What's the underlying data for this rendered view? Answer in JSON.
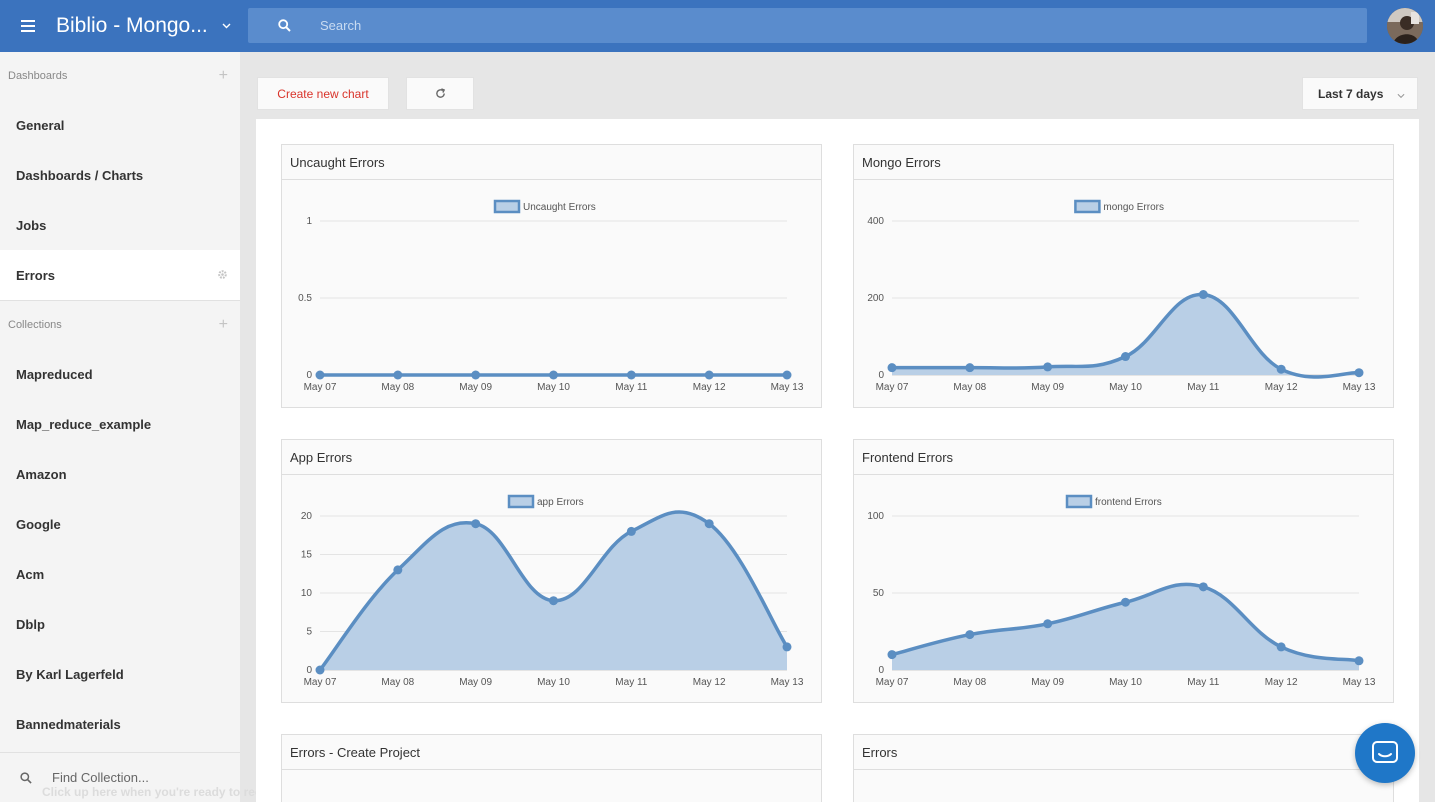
{
  "header": {
    "title": "Biblio - Mongo...",
    "search_placeholder": "Search",
    "menu_icon": "hamburger-icon",
    "avatar_icon": "user-avatar"
  },
  "sidebar": {
    "dashboards_heading": "Dashboards",
    "dashboards": [
      {
        "label": "General"
      },
      {
        "label": "Dashboards / Charts"
      },
      {
        "label": "Jobs"
      },
      {
        "label": "Errors",
        "active": true
      }
    ],
    "collections_heading": "Collections",
    "collections": [
      {
        "label": "Mapreduced"
      },
      {
        "label": "Map_reduce_example"
      },
      {
        "label": "Amazon"
      },
      {
        "label": "Google"
      },
      {
        "label": "Acm"
      },
      {
        "label": "Dblp"
      },
      {
        "label": "By Karl Lagerfeld"
      },
      {
        "label": "Bannedmaterials"
      }
    ],
    "find_placeholder": "Find Collection...",
    "record_hint": "Click up here when you're ready to record!"
  },
  "toolbar": {
    "create_label": "Create new chart",
    "refresh_icon": "refresh-icon",
    "range_label": "Last 7 days"
  },
  "colors": {
    "topbar": "#3b73be",
    "line": "#5b8ec2",
    "fill": "#b9cfe6",
    "accent_red": "#d9342b"
  },
  "chart_data": [
    {
      "type": "line",
      "title": "Uncaught Errors",
      "legend": "Uncaught Errors",
      "categories": [
        "May 07",
        "May 08",
        "May 09",
        "May 10",
        "May 11",
        "May 12",
        "May 13"
      ],
      "values": [
        0,
        0,
        0,
        0,
        0,
        0,
        0
      ],
      "ylim": [
        0,
        1
      ],
      "yticks": [
        "0",
        "0.5",
        "1"
      ],
      "area": false
    },
    {
      "type": "area",
      "title": "Mongo Errors",
      "legend": "mongo Errors",
      "categories": [
        "May 07",
        "May 08",
        "May 09",
        "May 10",
        "May 11",
        "May 12",
        "May 13"
      ],
      "values": [
        19,
        19,
        21,
        48,
        209,
        15,
        6
      ],
      "ylim": [
        0,
        400
      ],
      "yticks": [
        "0",
        "200",
        "400"
      ],
      "area": true
    },
    {
      "type": "area",
      "title": "App Errors",
      "legend": "app Errors",
      "categories": [
        "May 07",
        "May 08",
        "May 09",
        "May 10",
        "May 11",
        "May 12",
        "May 13"
      ],
      "values": [
        0,
        13,
        19,
        9,
        18,
        19,
        3
      ],
      "ylim": [
        0,
        20
      ],
      "yticks": [
        "0",
        "5",
        "10",
        "15",
        "20"
      ],
      "area": true
    },
    {
      "type": "area",
      "title": "Frontend Errors",
      "legend": "frontend Errors",
      "categories": [
        "May 07",
        "May 08",
        "May 09",
        "May 10",
        "May 11",
        "May 12",
        "May 13"
      ],
      "values": [
        10,
        23,
        30,
        44,
        54,
        15,
        6
      ],
      "ylim": [
        0,
        100
      ],
      "yticks": [
        "0",
        "50",
        "100"
      ],
      "area": true
    }
  ],
  "cards_bottom": [
    {
      "title": "Errors - Create Project"
    },
    {
      "title": "Errors"
    }
  ]
}
